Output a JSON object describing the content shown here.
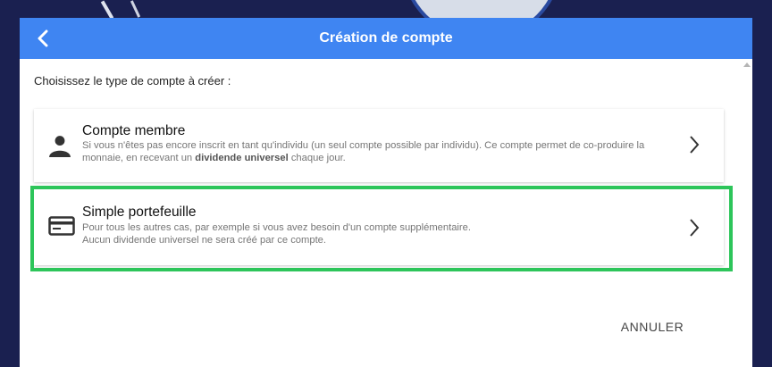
{
  "header": {
    "title": "Création de compte",
    "back_icon": "arrow-back-icon"
  },
  "prompt": "Choisissez le type de compte à créer :",
  "options": [
    {
      "icon": "person-icon",
      "title": "Compte membre",
      "desc_before": "Si vous n'êtes pas encore inscrit en tant qu'individu (un seul compte possible par individu). Ce compte permet de co-produire la monnaie, en recevant un ",
      "desc_bold": "dividende universel",
      "desc_after": " chaque jour."
    },
    {
      "icon": "credit-card-icon",
      "title": "Simple portefeuille",
      "desc_line1": "Pour tous les autres cas, par exemple si vous avez besoin d'un compte supplémentaire.",
      "desc_line2": "Aucun dividende universel ne sera créé par ce compte."
    }
  ],
  "cancel_label": "ANNULER",
  "colors": {
    "header": "#3f85f2",
    "highlight": "#2dc55a",
    "backdrop": "#1a2050"
  }
}
